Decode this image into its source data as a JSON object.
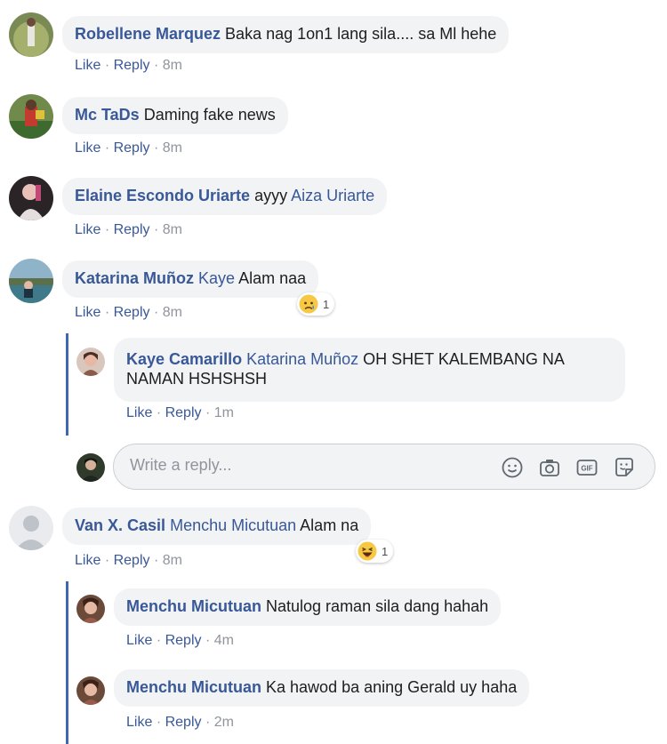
{
  "actions": {
    "like": "Like",
    "reply": "Reply",
    "separator": "·"
  },
  "comments": [
    {
      "author": "Robellene Marquez",
      "text": "Baka nag 1on1 lang sila.... sa Ml hehe",
      "time": "8m"
    },
    {
      "author": "Mc TaDs",
      "text": "Daming fake news",
      "time": "8m"
    },
    {
      "author": "Elaine Escondo Uriarte",
      "text": "ayyy",
      "tag": "Aiza Uriarte",
      "time": "8m"
    },
    {
      "author": "Katarina Muñoz",
      "tag": "Kaye",
      "text": "Alam naa",
      "time": "8m",
      "reaction": {
        "icon": "sad-reaction-icon",
        "count": "1"
      },
      "replies": [
        {
          "author": "Kaye Camarillo",
          "tag": "Katarina Muñoz",
          "text": "OH SHET KALEMBANG NA NAMAN HSHSHSH",
          "time": "1m"
        }
      ]
    },
    {
      "author": "Van X. Casil",
      "tag": "Menchu Micutuan",
      "text": "Alam na",
      "time": "8m",
      "reaction": {
        "icon": "haha-reaction-icon",
        "count": "1"
      },
      "replies": [
        {
          "author": "Menchu Micutuan",
          "text": "Natulog raman sila dang hahah",
          "time": "4m"
        },
        {
          "author": "Menchu Micutuan",
          "text": "Ka hawod ba aning Gerald uy haha",
          "time": "2m"
        }
      ]
    }
  ],
  "reply_box": {
    "placeholder": "Write a reply...",
    "tools": [
      "emoji-icon",
      "camera-icon",
      "gif-icon",
      "sticker-icon"
    ],
    "tool_labels": {
      "gif": "GIF"
    }
  },
  "colors": {
    "link": "#385898",
    "bubble": "#f2f3f5",
    "thread_line": "#4267b2",
    "meta_gray": "#90949c"
  }
}
